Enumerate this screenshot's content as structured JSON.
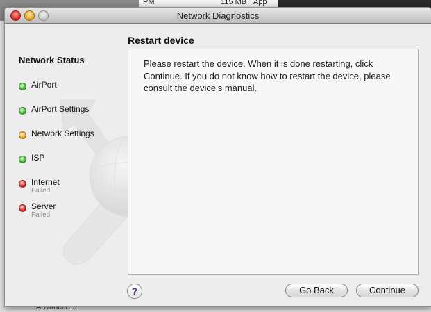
{
  "background": {
    "top_fragment_size": "115 MB",
    "top_fragment_pm": "PM",
    "top_fragment_app": "App",
    "bottom_fragment": "Advanced..."
  },
  "window": {
    "title": "Network Diagnostics"
  },
  "sidebar": {
    "heading": "Network Status",
    "items": [
      {
        "label": "AirPort",
        "status_color": "#3cbf2a",
        "sub": ""
      },
      {
        "label": "AirPort Settings",
        "status_color": "#3cbf2a",
        "sub": ""
      },
      {
        "label": "Network Settings",
        "status_color": "#f0a020",
        "sub": ""
      },
      {
        "label": "ISP",
        "status_color": "#3cbf2a",
        "sub": ""
      },
      {
        "label": "Internet",
        "status_color": "#e02222",
        "sub": "Failed"
      },
      {
        "label": "Server",
        "status_color": "#e02222",
        "sub": "Failed"
      }
    ]
  },
  "content": {
    "title": "Restart device",
    "message": "Please restart the device. When it is done restarting, click Continue. If you do not know how to restart the device, please consult the device’s manual."
  },
  "footer": {
    "help_label": "?",
    "back_label": "Go Back",
    "continue_label": "Continue"
  }
}
